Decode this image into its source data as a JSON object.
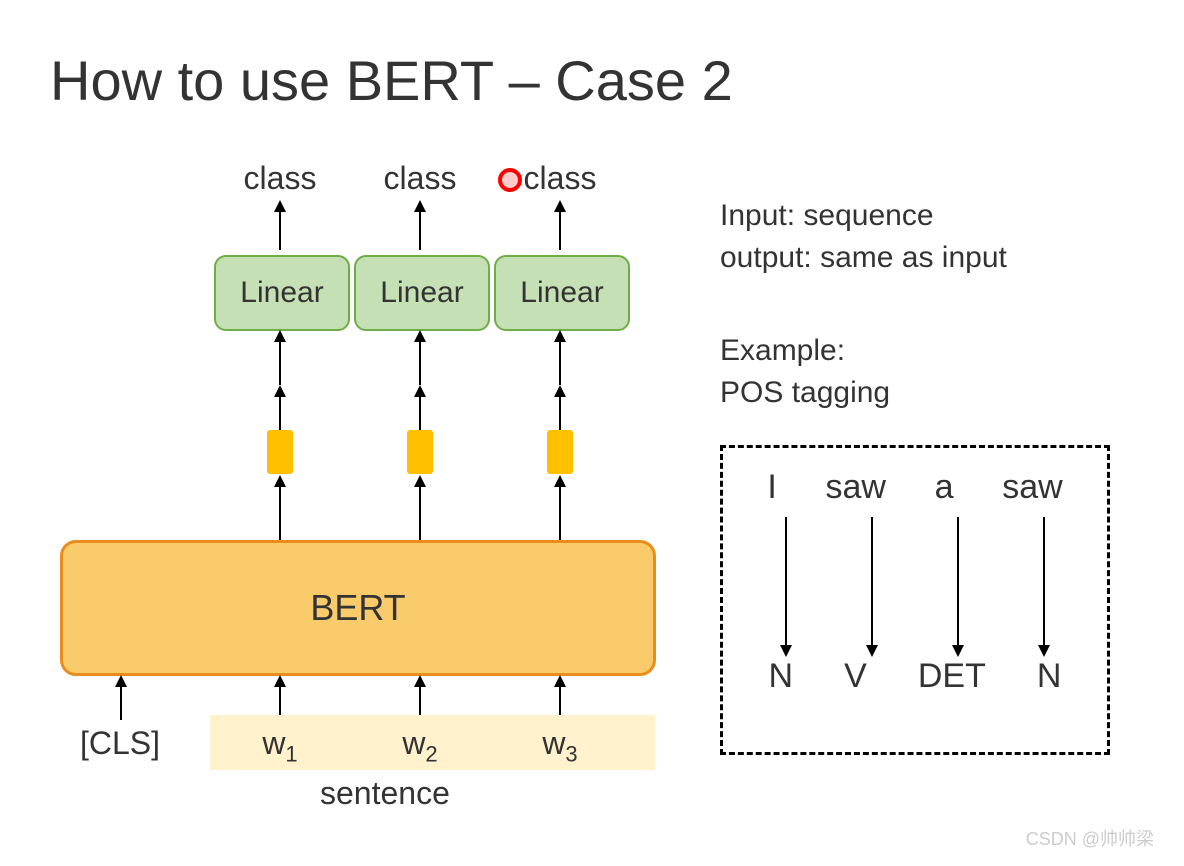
{
  "title": "How to use BERT – Case 2",
  "class_labels": [
    "class",
    "class",
    "class"
  ],
  "linear_labels": [
    "Linear",
    "Linear",
    "Linear"
  ],
  "bert_label": "BERT",
  "inputs": {
    "cls": "[CLS]",
    "w": [
      "w₁",
      "w₂",
      "w₃"
    ]
  },
  "sentence_label": "sentence",
  "right_block": {
    "line1": "Input: sequence",
    "line2": "output: same as input",
    "line3": "Example:",
    "line4": "POS tagging"
  },
  "example": {
    "top": [
      "I",
      "saw",
      "a",
      "saw"
    ],
    "bottom": [
      "N",
      "V",
      "DET",
      "N"
    ]
  },
  "watermark": "CSDN @帅帅梁"
}
